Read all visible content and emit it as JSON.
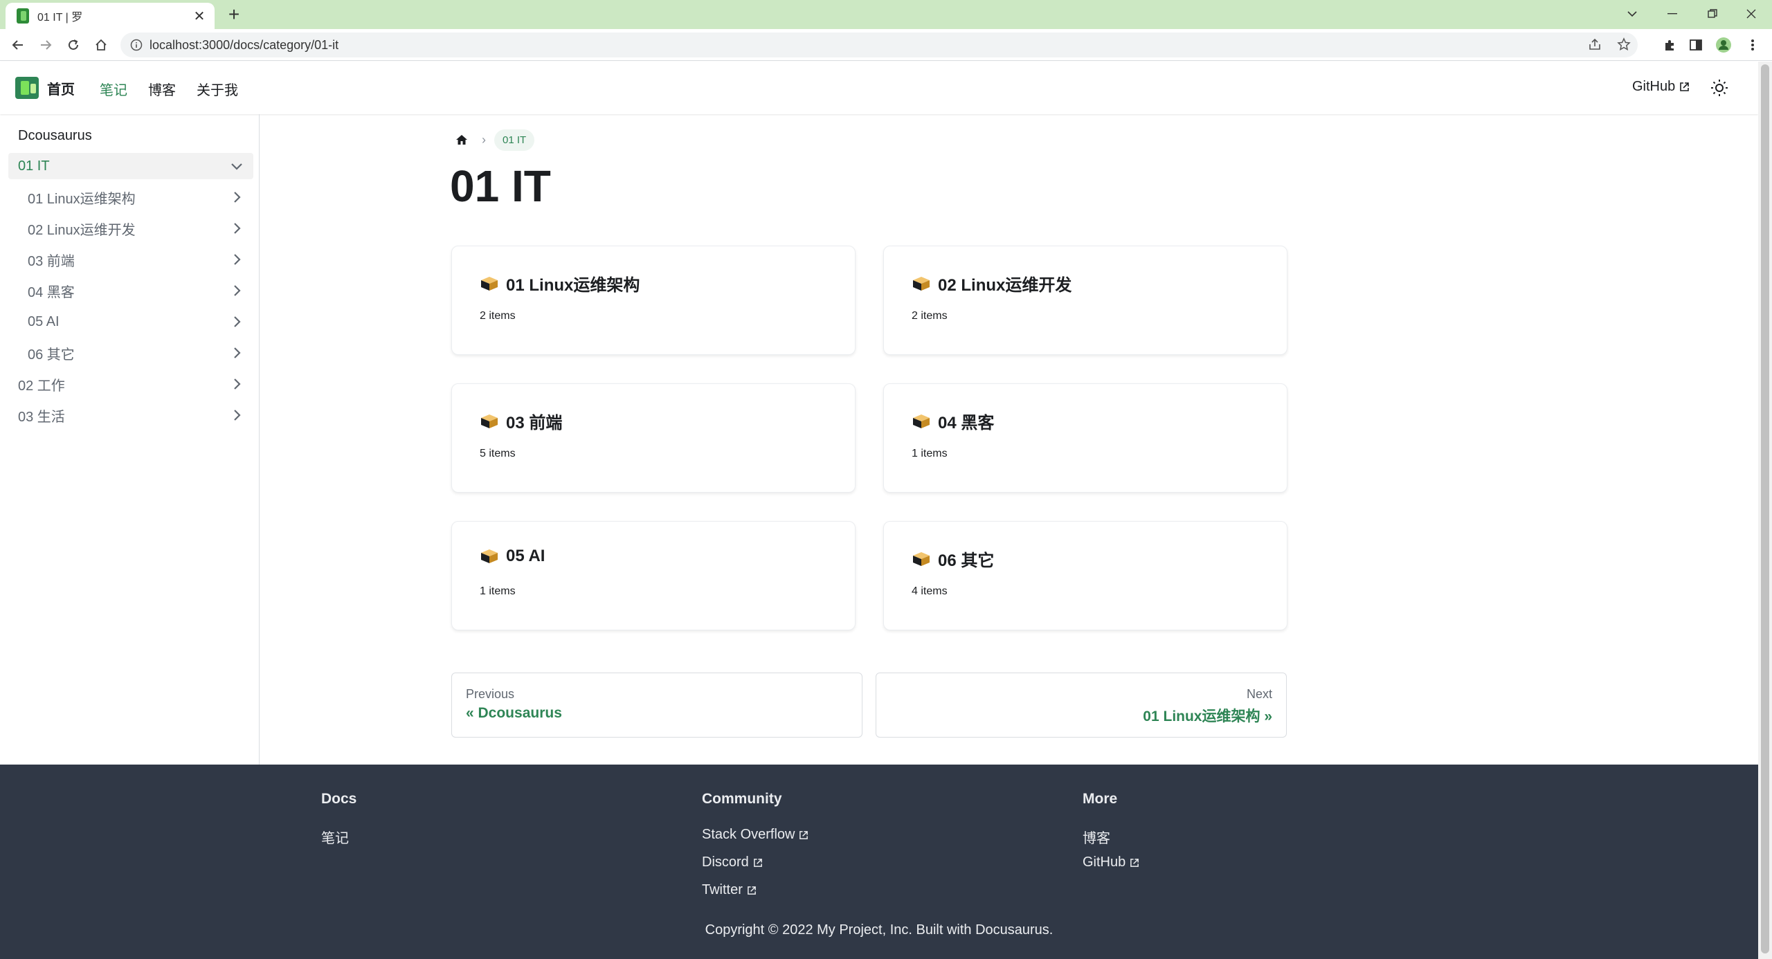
{
  "browser": {
    "tab_title": "01 IT | 罗",
    "url": "localhost:3000/docs/category/01-it"
  },
  "navbar": {
    "brand": "首页",
    "links": [
      "笔记",
      "博客",
      "关于我"
    ],
    "github": "GitHub"
  },
  "sidebar": {
    "items": [
      {
        "label": "Dcousaurus"
      },
      {
        "label": "01 IT"
      },
      {
        "label": "01 Linux运维架构"
      },
      {
        "label": "02 Linux运维开发"
      },
      {
        "label": "03 前端"
      },
      {
        "label": "04 黑客"
      },
      {
        "label": "05 AI"
      },
      {
        "label": "06 其它"
      },
      {
        "label": "02 工作"
      },
      {
        "label": "03 生活"
      }
    ]
  },
  "breadcrumb": {
    "current": "01 IT"
  },
  "page": {
    "title": "01 IT"
  },
  "cards": [
    {
      "title": "01 Linux运维架构",
      "desc": "2 items"
    },
    {
      "title": "02 Linux运维开发",
      "desc": "2 items"
    },
    {
      "title": "03 前端",
      "desc": "5 items"
    },
    {
      "title": "04 黑客",
      "desc": "1 items"
    },
    {
      "title": "05 AI",
      "desc": "1 items"
    },
    {
      "title": "06 其它",
      "desc": "4 items"
    }
  ],
  "pager": {
    "prev_sub": "Previous",
    "prev_label": "« Dcousaurus",
    "next_sub": "Next",
    "next_label": "01 Linux运维架构 »"
  },
  "footer": {
    "cols": [
      {
        "title": "Docs",
        "links": [
          "笔记"
        ]
      },
      {
        "title": "Community",
        "links": [
          "Stack Overflow",
          "Discord",
          "Twitter"
        ]
      },
      {
        "title": "More",
        "links": [
          "博客",
          "GitHub"
        ]
      }
    ],
    "copyright": "Copyright © 2022 My Project, Inc. Built with Docusaurus."
  },
  "colors": {
    "accent": "#2e8555",
    "footer_bg": "#303846",
    "tabbar_bg": "#cce8c3"
  }
}
